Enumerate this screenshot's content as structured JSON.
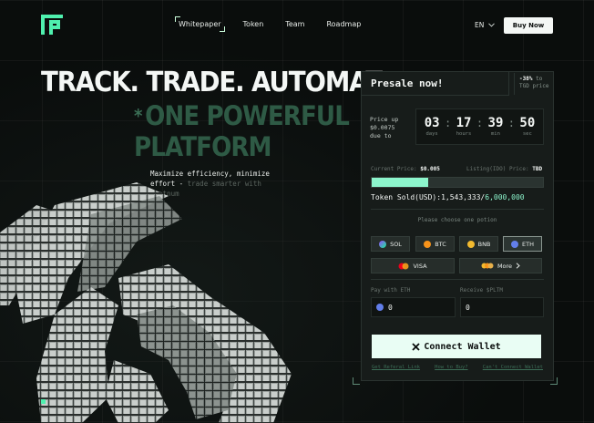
{
  "header": {
    "nav": [
      "Whitepaper",
      "Token",
      "Team",
      "Roadmap"
    ],
    "lang": "EN",
    "buy_label": "Buy Now"
  },
  "hero": {
    "title": "TRACK. TRADE. AUTOMATE",
    "sub_star": "*",
    "sub_line1": "ONE POWERFUL",
    "sub_line2": "PLATFORM",
    "desc_main": "Maximize efficiency, minimize effort - ",
    "desc_dim": "trade smarter with Platnum"
  },
  "presale": {
    "title": "Presale now!",
    "discount_pct": "-38%",
    "discount_to": "to",
    "discount_text": "TGD price",
    "price_up": "Price up $0.0075 due to",
    "timer": [
      {
        "num": "03",
        "label": "days"
      },
      {
        "num": "17",
        "label": "hours"
      },
      {
        "num": "39",
        "label": "min"
      },
      {
        "num": "50",
        "label": "sec"
      }
    ],
    "current_price_label": "Current Price:",
    "current_price": "$0.005",
    "listing_label": "Listing(IDO) Price:",
    "listing_price": "TBD",
    "progress_fraction": 0.33,
    "sold_label": "Token Sold(USD):",
    "sold_value": "1,543,333",
    "sold_sep": "/",
    "sold_total": "6,000,000",
    "choose": "Please choose one potion",
    "coins": [
      "SOL",
      "BTC",
      "BNB",
      "ETH"
    ],
    "visa": "VISA",
    "more": "More",
    "pay_label": "Pay with ETH",
    "receive_label": "Receive $PLTM",
    "pay_value": "0",
    "receive_value": "0",
    "connect": "Connect Wallet",
    "links": [
      "Get Referal Link",
      "How to Buy?",
      "Can't Connect Wallet"
    ]
  },
  "colors": {
    "accent": "#8cf5cc",
    "brand": "#4ff0ae",
    "dark_green": "#2e5a45"
  }
}
